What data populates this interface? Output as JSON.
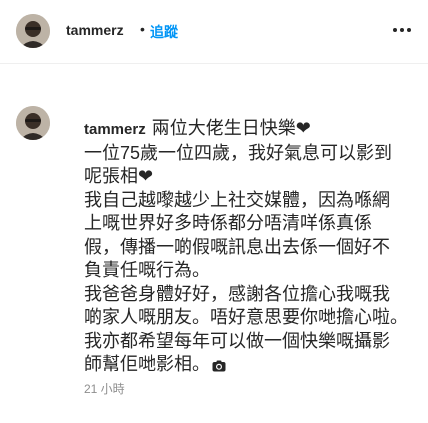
{
  "header": {
    "username": "tammerz",
    "dot": "•",
    "follow_label": "追蹤",
    "avatar_icon": "profile-avatar",
    "more_icon": "more-options-icon"
  },
  "post": {
    "username": "tammerz",
    "caption_lines": [
      "兩位大佬生日快樂❤",
      "一位75歲一位四歲，我好氣息可以影到",
      "呢張相❤",
      "我自己越嚟越少上社交媒體，因為喺網",
      "上嘅世界好多時係都分唔清咩係真係",
      "假，傳播一啲假嘅訊息出去係一個好不",
      "負責任嘅行為。",
      "我爸爸身體好好，感謝各位擔心我嘅我",
      "啲家人嘅朋友。唔好意思要你哋擔心啦。",
      "我亦都希望每年可以做一個快樂嘅攝影",
      "師幫佢哋影相。"
    ],
    "camera_icon": "camera-icon",
    "timestamp": "21 小時"
  }
}
